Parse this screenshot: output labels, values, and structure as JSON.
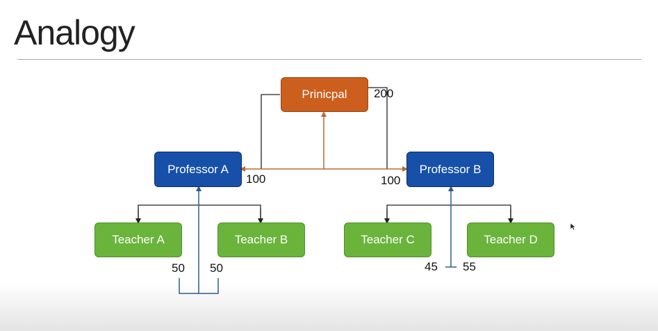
{
  "slide": {
    "title": "Analogy"
  },
  "nodes": {
    "principal": "Prinicpal",
    "professor_a": "Professor A",
    "professor_b": "Professor B",
    "teacher_a": "Teacher A",
    "teacher_b": "Teacher B",
    "teacher_c": "Teacher C",
    "teacher_d": "Teacher D"
  },
  "allocations": {
    "principal": "200",
    "professor_a": "100",
    "professor_b": "100",
    "teacher_a": "50",
    "teacher_b": "50",
    "teacher_c": "45",
    "teacher_d": "55"
  },
  "colors": {
    "principal": "#cc5f1d",
    "professor": "#1750a8",
    "teacher": "#6ab43b",
    "orange_arrow": "#b8683a",
    "blue_arrow": "#2f5b8c",
    "black_line": "#222222"
  },
  "icons": {
    "cursor": "mouse-pointer-icon"
  }
}
